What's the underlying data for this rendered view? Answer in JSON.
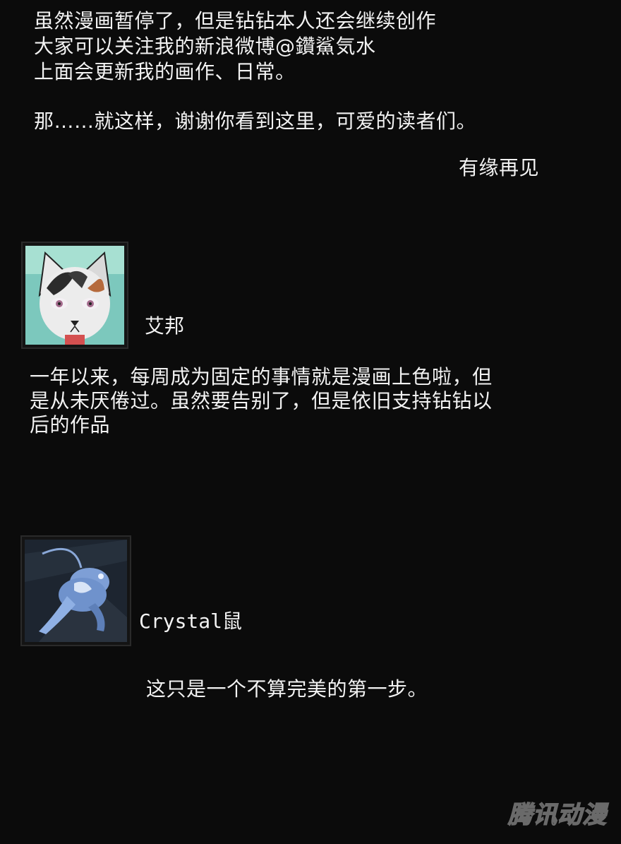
{
  "note": {
    "lines": [
      "虽然漫画暂停了，但是钻钻本人还会继续创作",
      "大家可以关注我的新浪微博@鑽鯊気水",
      "上面会更新我的画作、日常。",
      "那……就这样，谢谢你看到这里，可爱的读者们。"
    ],
    "signoff": "有缘再见"
  },
  "comments": [
    {
      "author": "艾邦",
      "avatar_icon": "cat-portrait-icon",
      "lines": [
        "一年以来，每周成为固定的事情就是漫画上色啦，但",
        "是从未厌倦过。虽然要告别了，但是依旧支持钻钻以",
        "后的作品"
      ]
    },
    {
      "author": "Crystal鼠",
      "avatar_icon": "crystal-creature-icon",
      "lines": [
        "这只是一个不算完美的第一步。"
      ]
    }
  ],
  "watermark": "腾讯动漫",
  "colors": {
    "background": "#0b0b0b",
    "text": "#f2f2f2"
  }
}
